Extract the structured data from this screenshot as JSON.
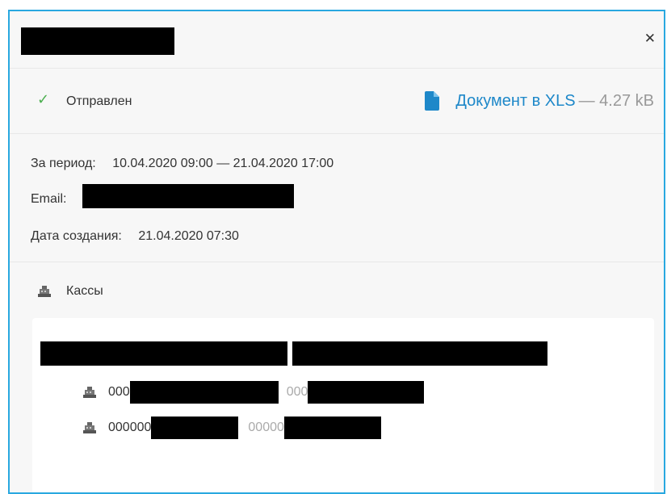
{
  "status": {
    "label": "Отправлен"
  },
  "document": {
    "link_label": "Документ в XLS",
    "size": "— 4.27 kB"
  },
  "info": {
    "period_label": "За период:",
    "period_value": "10.04.2020 09:00 — 21.04.2020 17:00",
    "email_label": "Email:",
    "created_label": "Дата создания:",
    "created_value": "21.04.2020 07:30"
  },
  "cash": {
    "title": "Кассы",
    "rows": [
      {
        "id_prefix": "000",
        "sub_prefix": "000"
      },
      {
        "id_prefix": "000000",
        "sub_prefix": "00000"
      }
    ]
  },
  "icons": {
    "close": "close-icon",
    "check": "check-icon",
    "document": "document-icon",
    "cash_register": "cash-register-icon"
  },
  "colors": {
    "accent": "#29a8e0",
    "link": "#1e88c9",
    "success": "#4caf50"
  }
}
